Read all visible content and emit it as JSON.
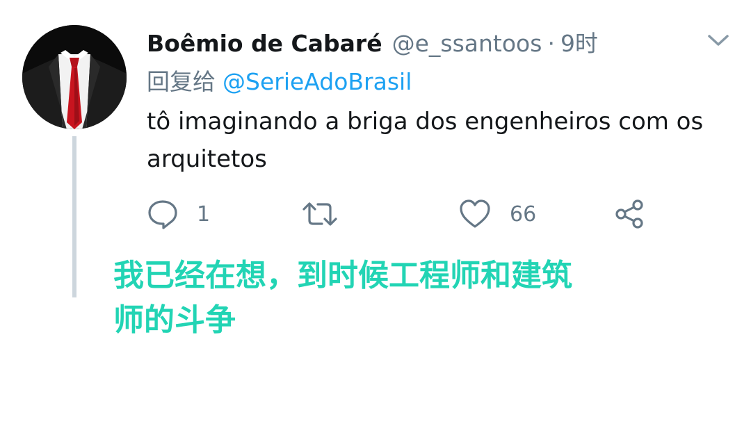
{
  "tweet": {
    "display_name": "Boêmio de Cabaré",
    "handle": "@e_ssantoos",
    "separator": "·",
    "time": "9时",
    "reply_prefix": "回复给",
    "reply_mention": "@SerieAdoBrasil",
    "text": "tô imaginando a briga dos engenheiros com os arquitetos",
    "avatar_icon": "suit-red-tie-avatar",
    "menu_icon": "chevron-down-icon"
  },
  "actions": {
    "reply": {
      "icon": "reply-bubble-icon",
      "count": "1"
    },
    "retweet": {
      "icon": "retweet-icon",
      "count": ""
    },
    "like": {
      "icon": "heart-icon",
      "count": "66"
    },
    "share": {
      "icon": "share-icon"
    }
  },
  "caption": {
    "line1": "我已经在想，到时候工程师和建筑",
    "line2": "师的斗争",
    "color": "#22d4b4"
  },
  "colors": {
    "name": "#14171a",
    "secondary": "#657786",
    "mention": "#1da1f2",
    "thread_line": "#cdd6dd"
  }
}
